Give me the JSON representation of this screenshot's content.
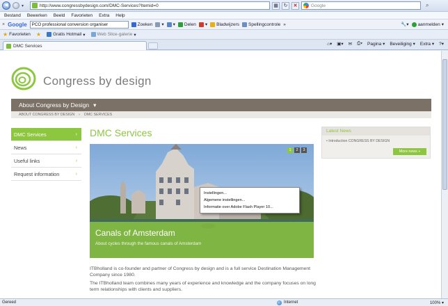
{
  "browser": {
    "url": "http://www.congressbydesign.com/DMC-Services?Itemid=0",
    "search_placeholder": "Google",
    "menu": [
      "Bestand",
      "Bewerken",
      "Beeld",
      "Favorieten",
      "Extra",
      "Help"
    ],
    "google_toolbar": {
      "brand": "Google",
      "query": "PCO professional conversion organiser",
      "buttons": [
        "Zoeken",
        "Delen",
        "Bladwijzers",
        "Spellingcontrole",
        "»"
      ],
      "signin": "aanmelden"
    },
    "favorites": {
      "label": "Favorieten",
      "items": [
        "Gratis Hotmail",
        "Web Slice-galerie"
      ]
    },
    "tab": {
      "title": "DMC Services"
    },
    "commands": [
      "Pagina",
      "Beveiliging",
      "Extra"
    ],
    "status": {
      "text": "Gereed",
      "zone": "Internet",
      "zoom": "100%"
    }
  },
  "site": {
    "brand": "Congress by design",
    "nav": {
      "label": "About Congress by Design",
      "arrow": "▾"
    },
    "breadcrumb": [
      "ABOUT CONGRESS BY DESIGN",
      "›",
      "DMC SERVICES"
    ],
    "sidebar": [
      {
        "label": "DMC Services",
        "active": true
      },
      {
        "label": "News",
        "active": false
      },
      {
        "label": "Useful links",
        "active": false
      },
      {
        "label": "Request information",
        "active": false
      }
    ],
    "page_title": "DMC Services",
    "hero": {
      "title": "Canals of Amsterdam",
      "subtitle": "About cycles through the famous canals of Amsterdam",
      "pager": [
        "1",
        "2",
        "3"
      ]
    },
    "context_menu": [
      "Instellingen...",
      "Algemene instellingen...",
      "Informatie over Adobe Flash Player 10..."
    ],
    "body": [
      "ITBholland is co-founder and partner of Congress by design and is a full service Destination Management Company since 1980.",
      "The ITBholland team combines many years of experience and knowledge and the company focuses on long term relationships with clients and suppliers."
    ],
    "latest_news": {
      "heading": "Latest News",
      "item": "Introduction CONGRESS BY DESIGN",
      "more": "More news »"
    },
    "colors": {
      "accent": "#8dc63f",
      "nav": "#7b7167"
    }
  }
}
